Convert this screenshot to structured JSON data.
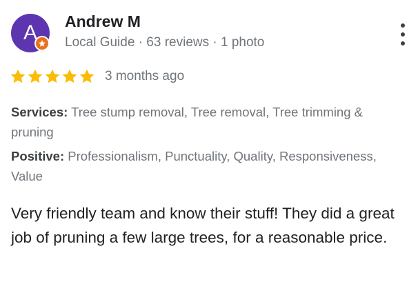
{
  "author": {
    "name": "Andrew M",
    "avatar_initial": "A",
    "avatar_color": "#5e35b1",
    "badge_icon": "star-icon",
    "meta": "Local Guide · 63 reviews · 1 photo"
  },
  "rating": {
    "stars": 5,
    "max_stars": 5,
    "star_color": "#fbbc04",
    "date": "3 months ago"
  },
  "attributes": {
    "services_label": "Services:",
    "services_value": "Tree stump removal, Tree removal, Tree trimming & pruning",
    "positive_label": "Positive:",
    "positive_value": "Professionalism, Punctuality, Quality, Responsiveness, Value"
  },
  "review": {
    "text": "Very friendly team and know their stuff! They did a great job of pruning a few large trees, for a reasonable price."
  },
  "menu": {
    "icon": "more-vert-icon"
  }
}
